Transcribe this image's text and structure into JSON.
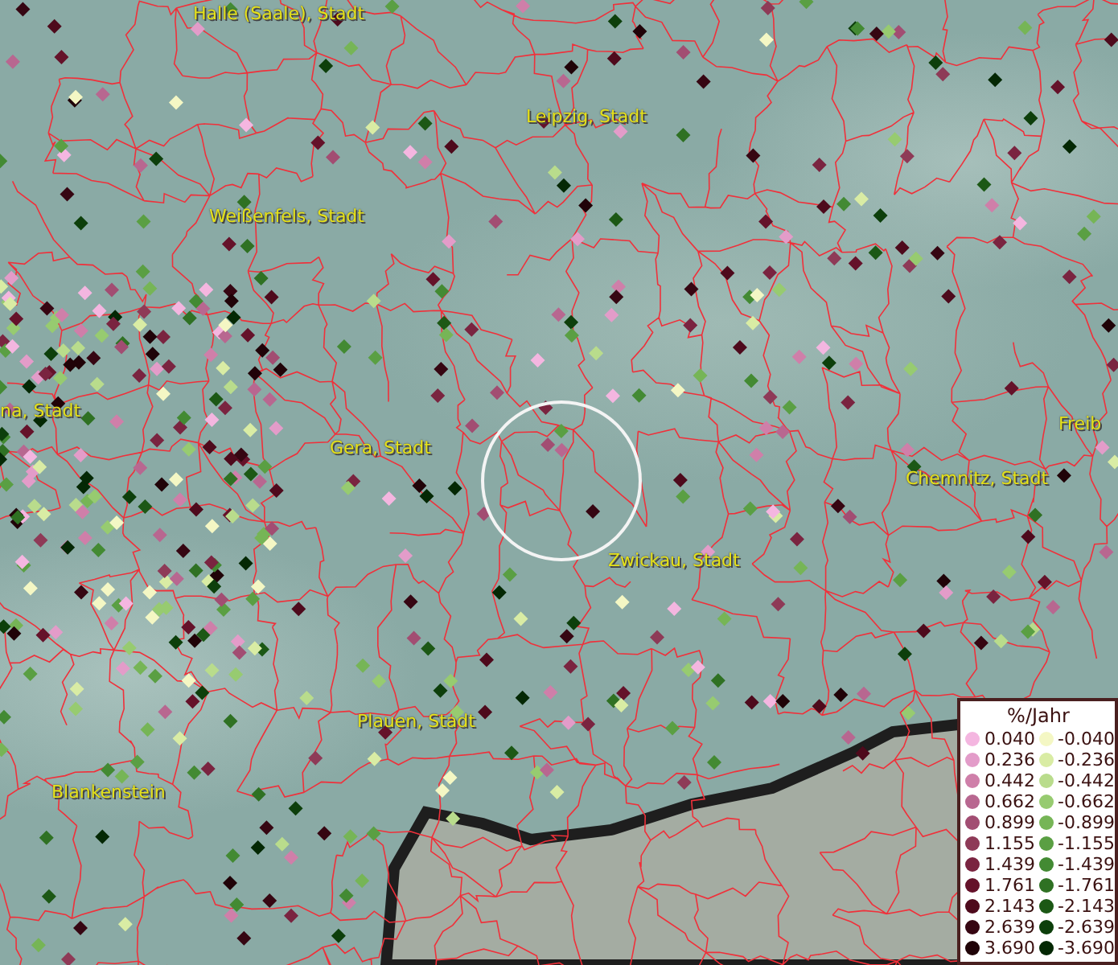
{
  "map": {
    "places": [
      {
        "name": "Halle (Saale), Stadt"
      },
      {
        "name": "Leipzig, Stadt"
      },
      {
        "name": "Weißenfels, Stadt"
      },
      {
        "name": "na, Stadt"
      },
      {
        "name": "Gera, Stadt"
      },
      {
        "name": "Chemnitz, Stadt"
      },
      {
        "name": "Freib"
      },
      {
        "name": "Zwickau, Stadt"
      },
      {
        "name": "Plauen, Stadt"
      },
      {
        "name": "Blankenstein"
      }
    ]
  },
  "legend": {
    "title": "%/Jahr",
    "items": [
      {
        "label": "0.040",
        "color": "#f4b6e0"
      },
      {
        "label": "0.236",
        "color": "#e39cc9"
      },
      {
        "label": "0.442",
        "color": "#cf7fa9"
      },
      {
        "label": "0.662",
        "color": "#b86790"
      },
      {
        "label": "0.899",
        "color": "#a24d72"
      },
      {
        "label": "1.155",
        "color": "#8e3a57"
      },
      {
        "label": "1.439",
        "color": "#7a2440"
      },
      {
        "label": "1.761",
        "color": "#65122a"
      },
      {
        "label": "2.143",
        "color": "#4e0a1c"
      },
      {
        "label": "2.639",
        "color": "#360612"
      },
      {
        "label": "3.690",
        "color": "#200308"
      },
      {
        "label": "-0.040",
        "color": "#f4f7c4"
      },
      {
        "label": "-0.236",
        "color": "#d9eca4"
      },
      {
        "label": "-0.442",
        "color": "#b9dc8c"
      },
      {
        "label": "-0.662",
        "color": "#97cb70"
      },
      {
        "label": "-0.899",
        "color": "#76b556"
      },
      {
        "label": "-1.155",
        "color": "#5a9f43"
      },
      {
        "label": "-1.439",
        "color": "#438a33"
      },
      {
        "label": "-1.761",
        "color": "#2f7123"
      },
      {
        "label": "-2.143",
        "color": "#1c5815"
      },
      {
        "label": "-2.639",
        "color": "#0d3f0b"
      },
      {
        "label": "-3.690",
        "color": "#042804"
      }
    ]
  }
}
